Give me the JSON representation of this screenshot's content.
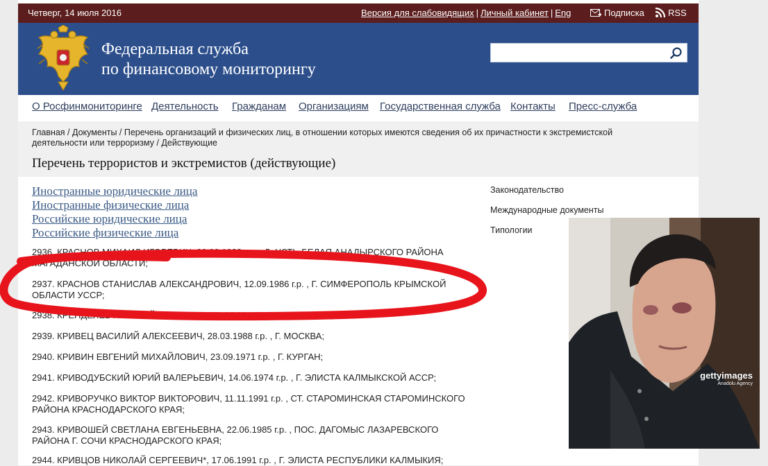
{
  "topbar": {
    "date": "Четверг, 14 июля 2016",
    "links": [
      "Версия для слабовидящих",
      "Личный кабинет",
      "Eng"
    ],
    "subscribe_label": "Подписка",
    "rss_label": "RSS"
  },
  "header": {
    "org_line1": "Федеральная служба",
    "org_line2": "по финансовому мониторингу",
    "search_value": ""
  },
  "nav": {
    "items": [
      "О Росфинмониторинге",
      "Деятельность",
      "Гражданам",
      "Организациям",
      "Государственная служба",
      "Контакты",
      "Пресс-служба"
    ]
  },
  "breadcrumb": "Главная / Документы / Перечень организаций и физических лиц, в отношении которых имеются сведения об их причастности к экстремистской деятельности или терроризму / Действующие",
  "page_title": "Перечень террористов и экстремистов (действующие)",
  "categories": [
    "Иностранные юридические лица",
    "Иностранные физические лица",
    "Российские юридические лица",
    "Российские физические лица"
  ],
  "entries": [
    "2936. КРАСНОВ МИХАИЛ ИГОРЕВИЧ, 22.02.1988 г.р. , Д. УСТЬ-БЕЛАЯ АНАДЫРСКОГО РАЙОНА МАГАДАНСКОЙ ОБЛАСТИ;",
    "2937. КРАСНОВ СТАНИСЛАВ АЛЕКСАНДРОВИЧ, 12.09.1986 г.р. , Г. СИМФЕРОПОЛЬ КРЫМСКОЙ ОБЛАСТИ УССР;",
    "2938. КРЕНДЕЛЕВ АЛЕКСЕЙ АЛЕКСЕЕВИЧ, 14.01.1998 г.р. , Г. ПЕНЗА;",
    "2939. КРИВЕЦ ВАСИЛИЙ АЛЕКСЕЕВИЧ, 28.03.1988 г.р. , Г. МОСКВА;",
    "2940. КРИВИН ЕВГЕНИЙ МИХАЙЛОВИЧ, 23.09.1971 г.р. , Г. КУРГАН;",
    "2941. КРИВОДУБСКИЙ ЮРИЙ ВАЛЕРЬЕВИЧ, 14.06.1974 г.р. , Г. ЭЛИСТА КАЛМЫКСКОЙ АССР;",
    "2942. КРИВОРУЧКО ВИКТОР ВИКТОРОВИЧ, 11.11.1991 г.р. , СТ. СТАРОМИНСКАЯ СТАРОМИНСКОГО РАЙОНА КРАСНОДАРСКОГО КРАЯ;",
    "2943. КРИВОШЕЙ СВЕТЛАНА ЕВГЕНЬЕВНА, 22.06.1985 г.р. , ПОС. ДАГОМЫС ЛАЗАРЕВСКОГО РАЙОНА Г. СОЧИ КРАСНОДАРСКОГО КРАЯ;",
    "2944. КРИВЦОВ НИКОЛАЙ СЕРГЕЕВИЧ*, 17.06.1991 г.р. , Г. ЭЛИСТА РЕСПУБЛИКИ КАЛМЫКИЯ;"
  ],
  "sidebar": {
    "items": [
      "Законодательство",
      "Международные документы",
      "Типологии"
    ]
  },
  "photo": {
    "watermark": "gettyimages",
    "watermark_sub": "Anadolu Agency"
  },
  "colors": {
    "topbar": "#5b1d1d",
    "header": "#2c4f8c",
    "highlight": "#e8141c",
    "link": "#3a5a85"
  }
}
